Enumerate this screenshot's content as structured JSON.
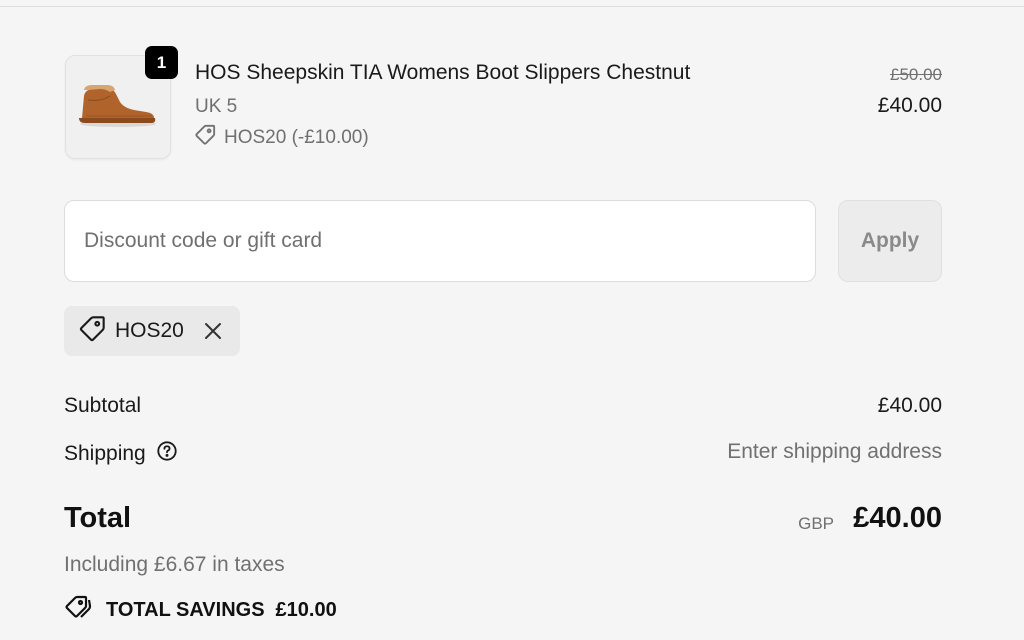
{
  "line_item": {
    "quantity": "1",
    "name": "HOS Sheepskin TIA Womens Boot Slippers Chestnut",
    "variant": "UK 5",
    "discount": "HOS20 (-£10.00)",
    "compare_price": "£50.00",
    "price": "£40.00",
    "image_icon": "chestnut-boot-slipper"
  },
  "discount_form": {
    "placeholder": "Discount code or gift card",
    "value": "",
    "apply_label": "Apply"
  },
  "applied_code": {
    "label": "HOS20",
    "icon": "tag-icon",
    "remove_icon": "close-icon"
  },
  "summary": {
    "subtotal_label": "Subtotal",
    "subtotal_value": "£40.00",
    "shipping_label": "Shipping",
    "shipping_value": "Enter shipping address",
    "total_label": "Total",
    "currency": "GBP",
    "total_value": "£40.00",
    "taxes_note": "Including £6.67 in taxes",
    "savings_label": "TOTAL SAVINGS",
    "savings_value": "£10.00"
  },
  "colors": {
    "background": "#f5f5f5",
    "text_primary": "#1a1a1a",
    "text_secondary": "#707070",
    "badge": "#000000",
    "product_color": "#b0642c"
  }
}
